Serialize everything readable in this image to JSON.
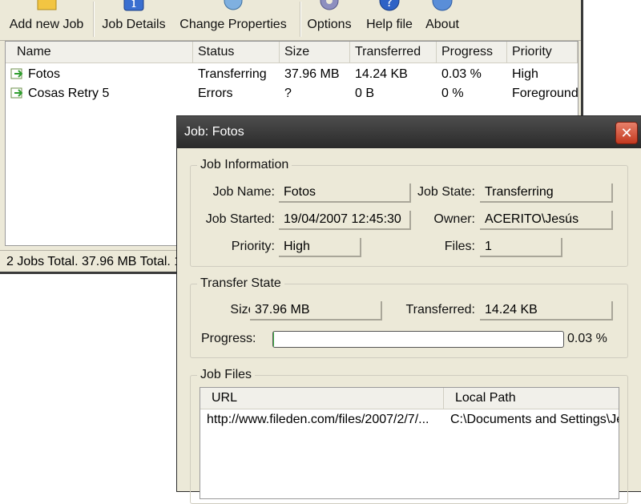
{
  "toolbar": {
    "buttons": [
      {
        "label": "Add new Job",
        "icon": "add-job-icon"
      },
      {
        "label": "Job Details",
        "icon": "info-icon"
      },
      {
        "label": "Change Properties",
        "icon": "properties-icon"
      },
      {
        "label": "Options",
        "icon": "gear-icon"
      },
      {
        "label": "Help file",
        "icon": "help-icon"
      },
      {
        "label": "About",
        "icon": "about-icon"
      }
    ]
  },
  "jobs_table": {
    "columns": [
      "Name",
      "Status",
      "Size",
      "Transferred",
      "Progress",
      "Priority"
    ],
    "rows": [
      {
        "name": "Fotos",
        "status": "Transferring",
        "size": "37.96 MB",
        "transferred": "14.24 KB",
        "progress": "0.03 %",
        "priority": "High"
      },
      {
        "name": "Cosas Retry 5",
        "status": "Errors",
        "size": "?",
        "transferred": "0 B",
        "progress": "0 %",
        "priority": "Foreground"
      }
    ]
  },
  "statusbar": {
    "text": "2 Jobs Total. 37.96 MB Total. 1"
  },
  "dialog": {
    "title": "Job: Fotos",
    "close_label": "✕",
    "job_info": {
      "legend": "Job Information",
      "job_name_label": "Job Name:",
      "job_name": "Fotos",
      "job_state_label": "Job State:",
      "job_state": "Transferring",
      "job_started_label": "Job Started:",
      "job_started": "19/04/2007 12:45:30",
      "owner_label": "Owner:",
      "owner": "ACERITO\\Jesús",
      "priority_label": "Priority:",
      "priority": "High",
      "files_label": "Files:",
      "files": "1"
    },
    "transfer_state": {
      "legend": "Transfer State",
      "size_label": "Size:",
      "size": "37.96 MB",
      "transferred_label": "Transferred:",
      "transferred": "14.24 KB",
      "progress_label": "Progress:",
      "progress_text": "0.03 %",
      "progress_fraction": 0.0003
    },
    "job_files": {
      "legend": "Job Files",
      "columns": [
        "URL",
        "Local Path"
      ],
      "rows": [
        {
          "url": "http://www.fileden.com/files/2007/2/7/...",
          "local_path": "C:\\Documents and Settings\\Je"
        }
      ]
    }
  },
  "colors": {
    "window_face": "#ece9d8",
    "titlebar": "#2a2a2a",
    "close": "#c2391f",
    "progress": "#3cb043"
  }
}
